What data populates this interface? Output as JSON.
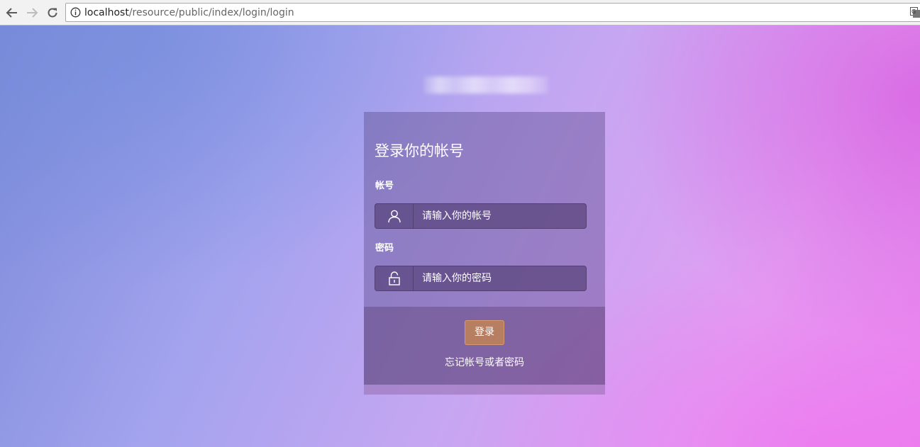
{
  "browser": {
    "url_host": "localhost",
    "url_path": "/resource/public/index/login/login",
    "icons": {
      "back": "arrow-left-icon",
      "forward": "arrow-right-icon",
      "reload": "reload-icon",
      "info": "info-icon",
      "translate": "translate-icon"
    }
  },
  "login": {
    "title": "登录你的帐号",
    "account_label": "帐号",
    "account_placeholder": "请输入你的帐号",
    "password_label": "密码",
    "password_placeholder": "请输入你的密码",
    "submit_label": "登录",
    "forgot_label": "忘记帐号或者密码",
    "icons": {
      "account": "user-icon",
      "password": "lock-icon"
    }
  },
  "colors": {
    "button": "#b77e62",
    "button_border": "#d79a6e",
    "text": "#ffffff"
  }
}
